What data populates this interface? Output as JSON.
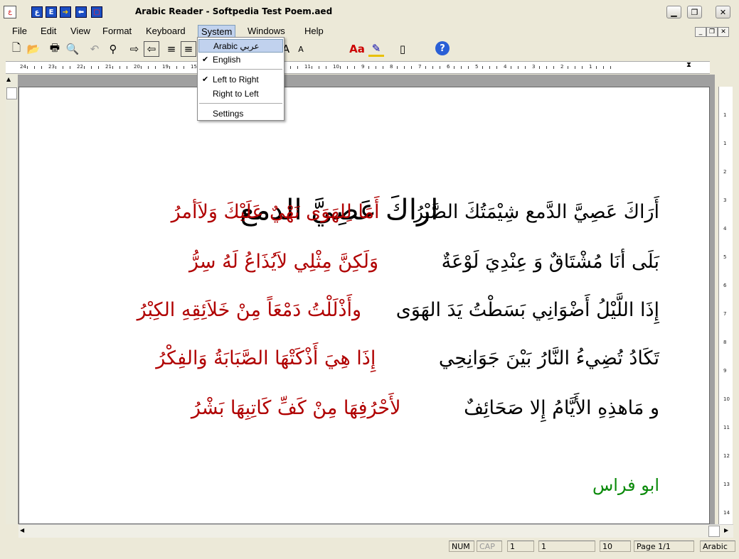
{
  "window": {
    "title": "Arabic Reader - Softpedia Test Poem.aed"
  },
  "menu": [
    "File",
    "Edit",
    "View",
    "Format",
    "Keyboard",
    "System",
    "Windows",
    "Help"
  ],
  "toolbar": {
    "font_size": "36"
  },
  "system_menu": {
    "items": [
      "Arabic عربي",
      "English",
      "Left  to Right",
      "Right to Left",
      "Settings"
    ],
    "checked": [
      "English",
      "Left  to Right"
    ]
  },
  "ruler": {
    "top_numbers": [
      "24",
      "23",
      "22",
      "21",
      "20",
      "19",
      "15",
      "14",
      "13",
      "12",
      "11",
      "10",
      "9",
      "8",
      "7",
      "6",
      "5",
      "4",
      "3",
      "2",
      "1"
    ],
    "side_numbers": [
      "1",
      "1",
      "2",
      "3",
      "4",
      "5",
      "6",
      "7",
      "8",
      "9",
      "10",
      "11",
      "12",
      "13",
      "14",
      "15"
    ]
  },
  "document": {
    "title": "اراكَ عَصِيَّ الدمع",
    "lines": [
      {
        "first": "أَرَاكَ عَصِيَّ الدَّمع شِيْمَتُكَ الصَّبْرُ",
        "second": "أَمَا لِلهَوَى نَهْيٌ عَلَيْكَ وَلاَأمرُ"
      },
      {
        "first": "بَلَى أنَا مُشْتَاقٌ وَ عِنْدِيَ لَوْعَةٌ",
        "second": "وَلَكِنَّ مِثْلِي لاَيُذَاعُ لَهُ سِرُّ"
      },
      {
        "first": "إِذَا اللَّيْلُ أَضْوَانِي بَسَطْتُ يَدَ الهَوَى",
        "second": "وأَذْلَلْتُ دَمْعَاً مِنْ خَلاَئِقِهِ الكِبْرُ"
      },
      {
        "first": "تَكَادُ تُضِيءُ النَّارُ بَيْنَ جَوَانِحِي",
        "second": "إِذَا هِيَ أَذْكَتْهَا الصَّبَابَةُ وَالفِكْرُ"
      },
      {
        "first": "و مَاهذِهِ الأَيَّامُ إِلا صَحَائِفٌ",
        "second": "لأَحْرُفِهَا مِنْ كَفِّ كَاتِبِهَا بَشْرُ"
      }
    ],
    "poet": "ابو فراس"
  },
  "status": {
    "num": "NUM",
    "cap": "CAP",
    "f1": "1",
    "f2": "1",
    "f3": "10",
    "page": "Page 1/1",
    "lang": "Arabic"
  }
}
